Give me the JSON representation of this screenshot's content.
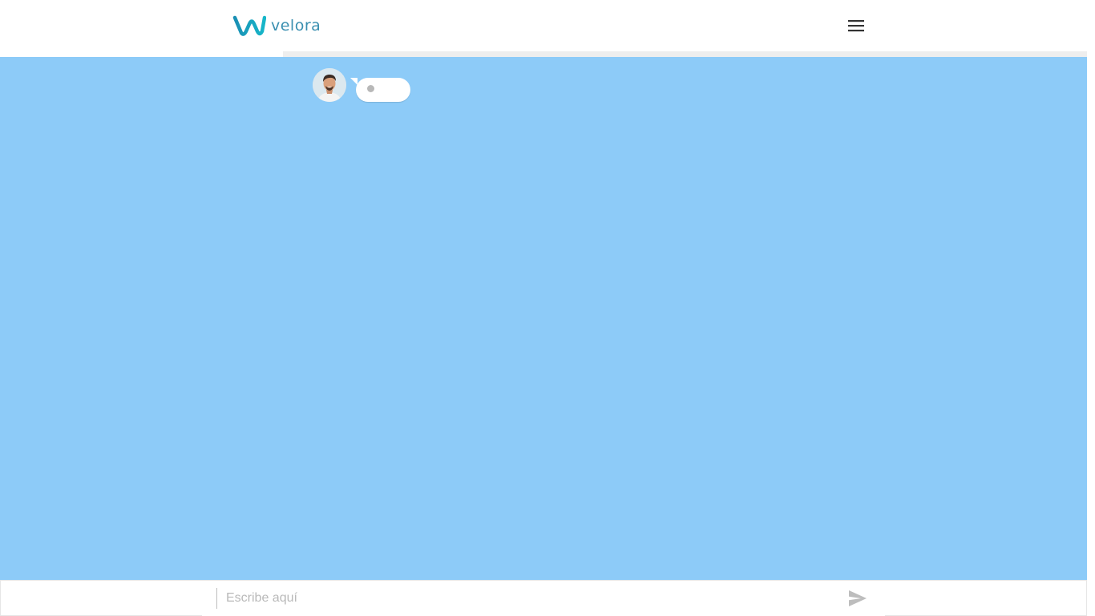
{
  "header": {
    "brand_name": "velora",
    "brand_color": "#1aa3c4",
    "menu_icon": "hamburger-menu-icon"
  },
  "chat": {
    "background_color": "#8dcbf8",
    "messages": [
      {
        "sender": "agent",
        "avatar": "agent-avatar",
        "status": "typing"
      }
    ]
  },
  "composer": {
    "placeholder": "Escribe aquí",
    "value": "",
    "send_icon": "send-icon"
  }
}
